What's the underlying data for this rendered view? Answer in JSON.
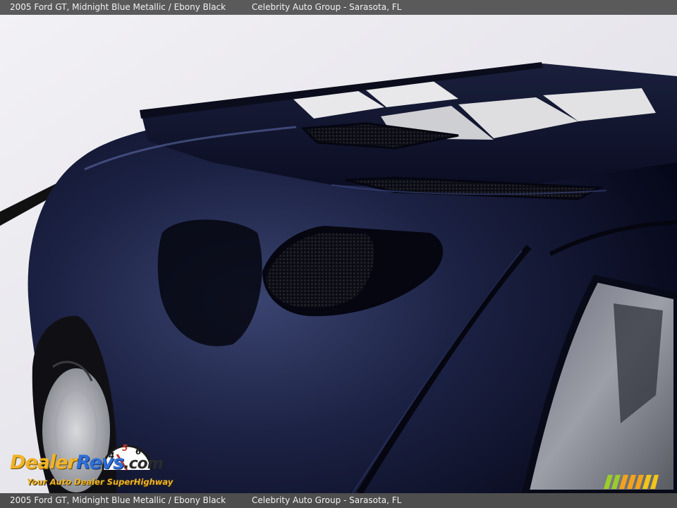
{
  "caption": {
    "vehicle": "2005 Ford GT,  Midnight Blue Metallic / Ebony Black",
    "dealer": "Celebrity Auto Group - Sarasota, FL"
  },
  "watermark": {
    "brand_part1": "Dealer",
    "brand_part2": "Revs",
    "brand_part3": ".com",
    "tagline": "Your Auto Dealer SuperHighway",
    "gauge_digits": [
      "4",
      "5",
      "6"
    ],
    "icon": "speedometer-icon",
    "stripe_icon": "racing-stripes-icon"
  },
  "colors": {
    "paint": "#10142a",
    "stripe": "#e8e8ea",
    "background": "#e9e8ee",
    "caption_bar": "#5a5a5a"
  }
}
